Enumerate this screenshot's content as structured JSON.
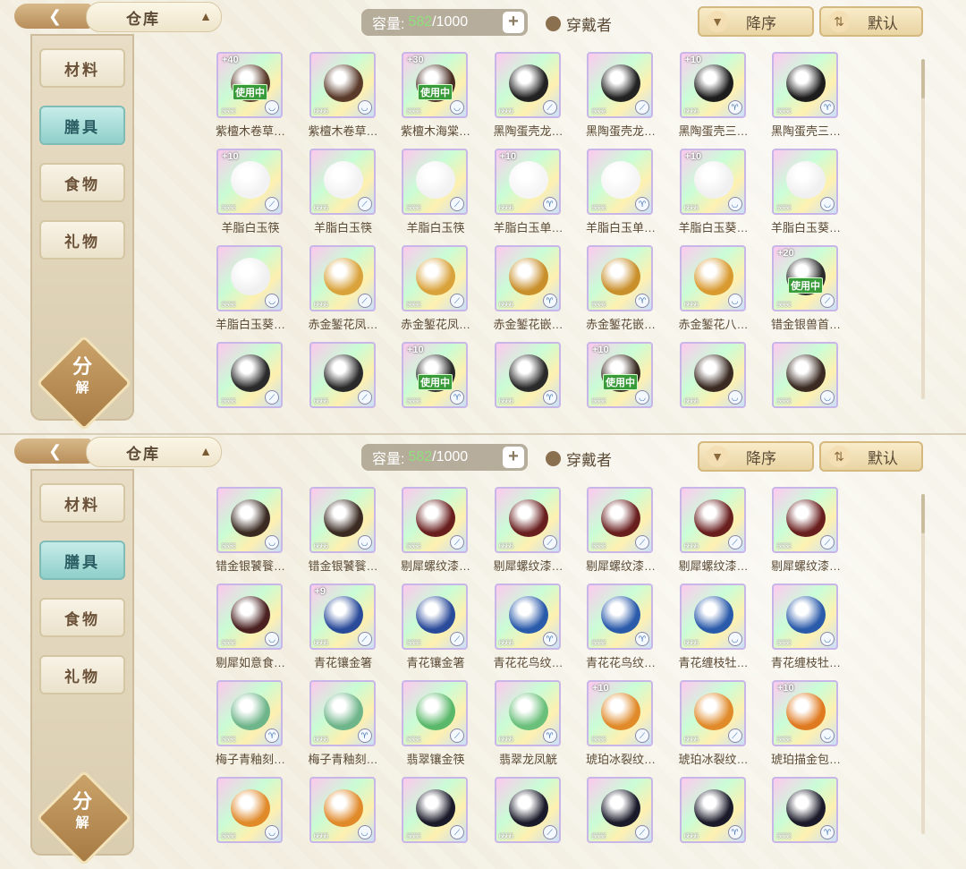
{
  "panels": [
    {
      "id": "a",
      "title": "仓库",
      "capacity": {
        "label": "容量:",
        "used": "582",
        "total": "/1000"
      },
      "wearer_label": "穿戴者",
      "sort_desc": "降序",
      "sort_default": "默认",
      "side_menu": [
        "材料",
        "膳具",
        "食物",
        "礼物"
      ],
      "active_tab": 1,
      "decompose": [
        "分",
        "解"
      ],
      "items": [
        {
          "name": "紫檀木卷草…",
          "plus": "+40",
          "inuse": "使用中",
          "stars": "6666",
          "badge": "bowl",
          "color": "#5a3a2a"
        },
        {
          "name": "紫檀木卷草…",
          "plus": "",
          "inuse": "",
          "stars": "6666",
          "badge": "bowl",
          "color": "#5a3a2a"
        },
        {
          "name": "紫檀木海棠…",
          "plus": "+30",
          "inuse": "使用中",
          "stars": "6666",
          "badge": "bowl",
          "color": "#4a2e24"
        },
        {
          "name": "黑陶蛋壳龙…",
          "plus": "",
          "inuse": "",
          "stars": "6666",
          "badge": "spoon",
          "color": "#222222"
        },
        {
          "name": "黑陶蛋壳龙…",
          "plus": "",
          "inuse": "",
          "stars": "6666",
          "badge": "spoon",
          "color": "#222222"
        },
        {
          "name": "黑陶蛋壳三…",
          "plus": "+10",
          "inuse": "",
          "stars": "6666",
          "badge": "cup",
          "color": "#1d1d1d"
        },
        {
          "name": "黑陶蛋壳三…",
          "plus": "",
          "inuse": "",
          "stars": "6666",
          "badge": "cup",
          "color": "#1d1d1d"
        },
        {
          "name": "羊脂白玉筷",
          "plus": "+10",
          "inuse": "",
          "stars": "6666",
          "badge": "spoon",
          "color": "#f2f2f2"
        },
        {
          "name": "羊脂白玉筷",
          "plus": "",
          "inuse": "",
          "stars": "6666",
          "badge": "spoon",
          "color": "#f2f2f2"
        },
        {
          "name": "羊脂白玉筷",
          "plus": "",
          "inuse": "",
          "stars": "6666",
          "badge": "spoon",
          "color": "#f2f2f2"
        },
        {
          "name": "羊脂白玉单…",
          "plus": "+10",
          "inuse": "",
          "stars": "6666",
          "badge": "cup",
          "color": "#f5f5f5"
        },
        {
          "name": "羊脂白玉单…",
          "plus": "",
          "inuse": "",
          "stars": "6666",
          "badge": "cup",
          "color": "#f5f5f5"
        },
        {
          "name": "羊脂白玉葵…",
          "plus": "+10",
          "inuse": "",
          "stars": "6666",
          "badge": "bowl",
          "color": "#f0f0f0"
        },
        {
          "name": "羊脂白玉葵…",
          "plus": "",
          "inuse": "",
          "stars": "6666",
          "badge": "bowl",
          "color": "#f0f0f0"
        },
        {
          "name": "羊脂白玉葵…",
          "plus": "",
          "inuse": "",
          "stars": "6666",
          "badge": "bowl",
          "color": "#f0f0f0"
        },
        {
          "name": "赤金錾花凤…",
          "plus": "",
          "inuse": "",
          "stars": "6666",
          "badge": "spoon",
          "color": "#d9a23a"
        },
        {
          "name": "赤金錾花凤…",
          "plus": "",
          "inuse": "",
          "stars": "6666",
          "badge": "spoon",
          "color": "#d9a23a"
        },
        {
          "name": "赤金錾花嵌…",
          "plus": "",
          "inuse": "",
          "stars": "6666",
          "badge": "cup",
          "color": "#c98f2a"
        },
        {
          "name": "赤金錾花嵌…",
          "plus": "",
          "inuse": "",
          "stars": "6666",
          "badge": "cup",
          "color": "#c98f2a"
        },
        {
          "name": "赤金錾花八…",
          "plus": "",
          "inuse": "",
          "stars": "6666",
          "badge": "bowl",
          "color": "#d99a30"
        },
        {
          "name": "错金银兽首…",
          "plus": "+20",
          "inuse": "使用中",
          "stars": "6666",
          "badge": "spoon",
          "color": "#2a2a2a"
        },
        {
          "name": "",
          "plus": "",
          "inuse": "",
          "stars": "6666",
          "badge": "spoon",
          "color": "#2a2a2a"
        },
        {
          "name": "",
          "plus": "",
          "inuse": "",
          "stars": "6666",
          "badge": "spoon",
          "color": "#2a2a2a"
        },
        {
          "name": "",
          "plus": "+10",
          "inuse": "使用中",
          "stars": "6666",
          "badge": "cup",
          "color": "#2a2a2a"
        },
        {
          "name": "",
          "plus": "",
          "inuse": "",
          "stars": "6666",
          "badge": "cup",
          "color": "#2a2a2a"
        },
        {
          "name": "",
          "plus": "+10",
          "inuse": "使用中",
          "stars": "6666",
          "badge": "bowl",
          "color": "#3a2a22"
        },
        {
          "name": "",
          "plus": "",
          "inuse": "",
          "stars": "6666",
          "badge": "bowl",
          "color": "#3a2a22"
        },
        {
          "name": "",
          "plus": "",
          "inuse": "",
          "stars": "6666",
          "badge": "bowl",
          "color": "#3a2a22"
        }
      ]
    },
    {
      "id": "b",
      "title": "仓库",
      "capacity": {
        "label": "容量:",
        "used": "582",
        "total": "/1000"
      },
      "wearer_label": "穿戴者",
      "sort_desc": "降序",
      "sort_default": "默认",
      "side_menu": [
        "材料",
        "膳具",
        "食物",
        "礼物"
      ],
      "active_tab": 1,
      "decompose": [
        "分",
        "解"
      ],
      "items": [
        {
          "name": "错金银饕餮…",
          "plus": "",
          "inuse": "",
          "stars": "6666",
          "badge": "bowl",
          "color": "#3a2a22"
        },
        {
          "name": "错金银饕餮…",
          "plus": "",
          "inuse": "",
          "stars": "6666",
          "badge": "bowl",
          "color": "#3a2a22"
        },
        {
          "name": "剔犀螺纹漆…",
          "plus": "",
          "inuse": "",
          "stars": "6666",
          "badge": "spoon",
          "color": "#6a1f1f"
        },
        {
          "name": "剔犀螺纹漆…",
          "plus": "",
          "inuse": "",
          "stars": "6666",
          "badge": "spoon",
          "color": "#6a1f1f"
        },
        {
          "name": "剔犀螺纹漆…",
          "plus": "",
          "inuse": "",
          "stars": "6666",
          "badge": "spoon",
          "color": "#6a1f1f"
        },
        {
          "name": "剔犀螺纹漆…",
          "plus": "",
          "inuse": "",
          "stars": "6666",
          "badge": "spoon",
          "color": "#6a1f1f"
        },
        {
          "name": "剔犀螺纹漆…",
          "plus": "",
          "inuse": "",
          "stars": "6666",
          "badge": "spoon",
          "color": "#6a1f1f"
        },
        {
          "name": "剔犀如意食…",
          "plus": "",
          "inuse": "",
          "stars": "6666",
          "badge": "bowl",
          "color": "#4a2020"
        },
        {
          "name": "青花镶金箸",
          "plus": "+9",
          "inuse": "",
          "stars": "6666",
          "badge": "spoon",
          "color": "#2a4a9a"
        },
        {
          "name": "青花镶金箸",
          "plus": "",
          "inuse": "",
          "stars": "6666",
          "badge": "spoon",
          "color": "#2a4a9a"
        },
        {
          "name": "青花花鸟纹…",
          "plus": "",
          "inuse": "",
          "stars": "6666",
          "badge": "cup",
          "color": "#2a5aaa"
        },
        {
          "name": "青花花鸟纹…",
          "plus": "",
          "inuse": "",
          "stars": "6666",
          "badge": "cup",
          "color": "#2a5aaa"
        },
        {
          "name": "青花缠枝牡…",
          "plus": "",
          "inuse": "",
          "stars": "6666",
          "badge": "bowl",
          "color": "#2a5aaa"
        },
        {
          "name": "青花缠枝牡…",
          "plus": "",
          "inuse": "",
          "stars": "6666",
          "badge": "bowl",
          "color": "#2a5aaa"
        },
        {
          "name": "梅子青釉刻…",
          "plus": "",
          "inuse": "",
          "stars": "6666",
          "badge": "cup",
          "color": "#6fb58a"
        },
        {
          "name": "梅子青釉刻…",
          "plus": "",
          "inuse": "",
          "stars": "6666",
          "badge": "cup",
          "color": "#6fb58a"
        },
        {
          "name": "翡翠镶金筷",
          "plus": "",
          "inuse": "",
          "stars": "6666",
          "badge": "spoon",
          "color": "#5ab86a"
        },
        {
          "name": "翡翠龙凤觥",
          "plus": "",
          "inuse": "",
          "stars": "6666",
          "badge": "cup",
          "color": "#6ac07a"
        },
        {
          "name": "琥珀冰裂纹…",
          "plus": "+10",
          "inuse": "",
          "stars": "6666",
          "badge": "spoon",
          "color": "#e08a2a"
        },
        {
          "name": "琥珀冰裂纹…",
          "plus": "",
          "inuse": "",
          "stars": "6666",
          "badge": "spoon",
          "color": "#e08a2a"
        },
        {
          "name": "琥珀描金包…",
          "plus": "+10",
          "inuse": "",
          "stars": "6666",
          "badge": "bowl",
          "color": "#e07a20"
        },
        {
          "name": "",
          "plus": "",
          "inuse": "",
          "stars": "6666",
          "badge": "bowl",
          "color": "#e08a2a"
        },
        {
          "name": "",
          "plus": "",
          "inuse": "",
          "stars": "6666",
          "badge": "bowl",
          "color": "#e08a2a"
        },
        {
          "name": "",
          "plus": "",
          "inuse": "",
          "stars": "6666",
          "badge": "spoon",
          "color": "#1a1a2a"
        },
        {
          "name": "",
          "plus": "",
          "inuse": "",
          "stars": "6666",
          "badge": "spoon",
          "color": "#1a1a2a"
        },
        {
          "name": "",
          "plus": "",
          "inuse": "",
          "stars": "6666",
          "badge": "spoon",
          "color": "#1a1a2a"
        },
        {
          "name": "",
          "plus": "",
          "inuse": "",
          "stars": "6666",
          "badge": "cup",
          "color": "#1a1a2a"
        },
        {
          "name": "",
          "plus": "",
          "inuse": "",
          "stars": "6666",
          "badge": "cup",
          "color": "#1a1a2a"
        }
      ]
    }
  ]
}
